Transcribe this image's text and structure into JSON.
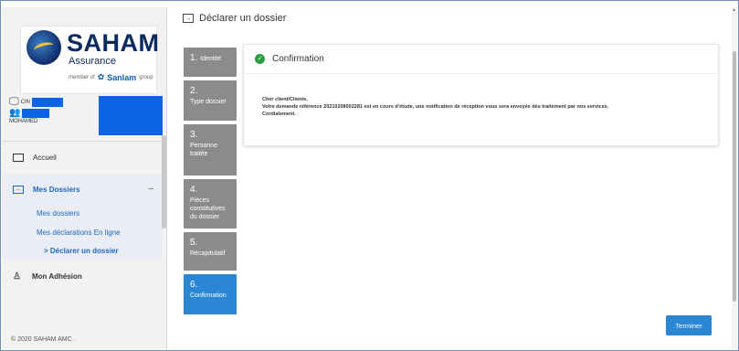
{
  "brand": {
    "title": "SAHAM",
    "subtitle": "Assurance",
    "member_prefix": "member of",
    "member_name": "Sanlam",
    "member_suffix": "group"
  },
  "user": {
    "id_prefix": "CIN",
    "name": "MOHAMED"
  },
  "nav": {
    "accueil": "Accueil",
    "mes_dossiers": "Mes Dossiers",
    "collapse_symbol": "–",
    "sub_items": [
      "Mes dossiers",
      "Mes déclarations En ligne",
      "Déclarer un dossier"
    ],
    "active_marker": ">",
    "mon_adhesion": "Mon Adhésion"
  },
  "footer": "© 2020 SAHAM AMC .",
  "page": {
    "title": "Déclarer un dossier"
  },
  "steps": [
    {
      "num": "1.",
      "label": "Identité"
    },
    {
      "num": "2.",
      "label": "Type dossier"
    },
    {
      "num": "3.",
      "label": "Personne traitée"
    },
    {
      "num": "4.",
      "label": "Pièces constitutives du dossier"
    },
    {
      "num": "5.",
      "label": "Récapitulatif"
    },
    {
      "num": "6.",
      "label": "Confirmation"
    }
  ],
  "active_step": 6,
  "card": {
    "title": "Confirmation",
    "line1": "Cher client/Cliente,",
    "line2": "Votre demande référence 20210208002281 est en cours d'étude, une notification de réception vous sera envoyée dès traitement par nos services.",
    "line3": "Cordialement."
  },
  "buttons": {
    "terminer": "Terminer"
  },
  "colors": {
    "accent": "#2a87d6",
    "step_inactive": "#8b8b8b",
    "success": "#2e9b45",
    "link": "#1a67c2",
    "redaction": "#0b63e5"
  }
}
